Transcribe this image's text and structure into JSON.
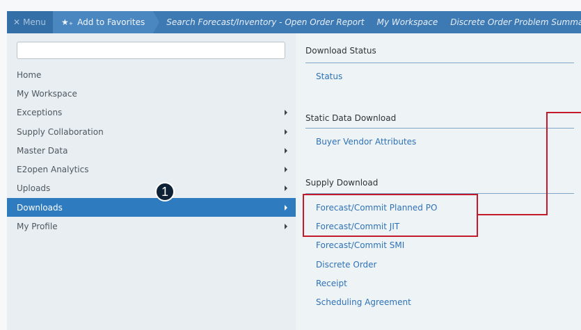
{
  "topbar": {
    "menu_label": "Menu",
    "menu_icon": "close-icon",
    "favorites_label": "Add to Favorites",
    "favorites_icon": "star-add-icon",
    "links": [
      "Search Forecast/Inventory - Open Order Report",
      "My Workspace",
      "Discrete Order Problem Summary"
    ]
  },
  "sidebar": {
    "search_value": "",
    "items": [
      {
        "label": "Home",
        "has_submenu": false
      },
      {
        "label": "My Workspace",
        "has_submenu": false
      },
      {
        "label": "Exceptions",
        "has_submenu": true
      },
      {
        "label": "Supply Collaboration",
        "has_submenu": true
      },
      {
        "label": "Master Data",
        "has_submenu": true
      },
      {
        "label": "E2open Analytics",
        "has_submenu": true
      },
      {
        "label": "Uploads",
        "has_submenu": true
      },
      {
        "label": "Downloads",
        "has_submenu": true,
        "active": true
      },
      {
        "label": "My Profile",
        "has_submenu": true
      }
    ],
    "step_badge": "1"
  },
  "main": {
    "sections": [
      {
        "title": "Download Status",
        "links": [
          "Status"
        ]
      },
      {
        "title": "Static Data Download",
        "links": [
          "Buyer Vendor Attributes"
        ]
      },
      {
        "title": "Supply Download",
        "links": [
          "Forecast/Commit Planned PO",
          "Forecast/Commit JIT",
          "Forecast/Commit SMI",
          "Discrete Order",
          "Receipt",
          "Scheduling Agreement"
        ]
      }
    ]
  },
  "colors": {
    "topbar": "#3d7ab4",
    "active_item": "#2e7bbf",
    "link": "#2e72b6",
    "highlight": "#c4182b"
  }
}
